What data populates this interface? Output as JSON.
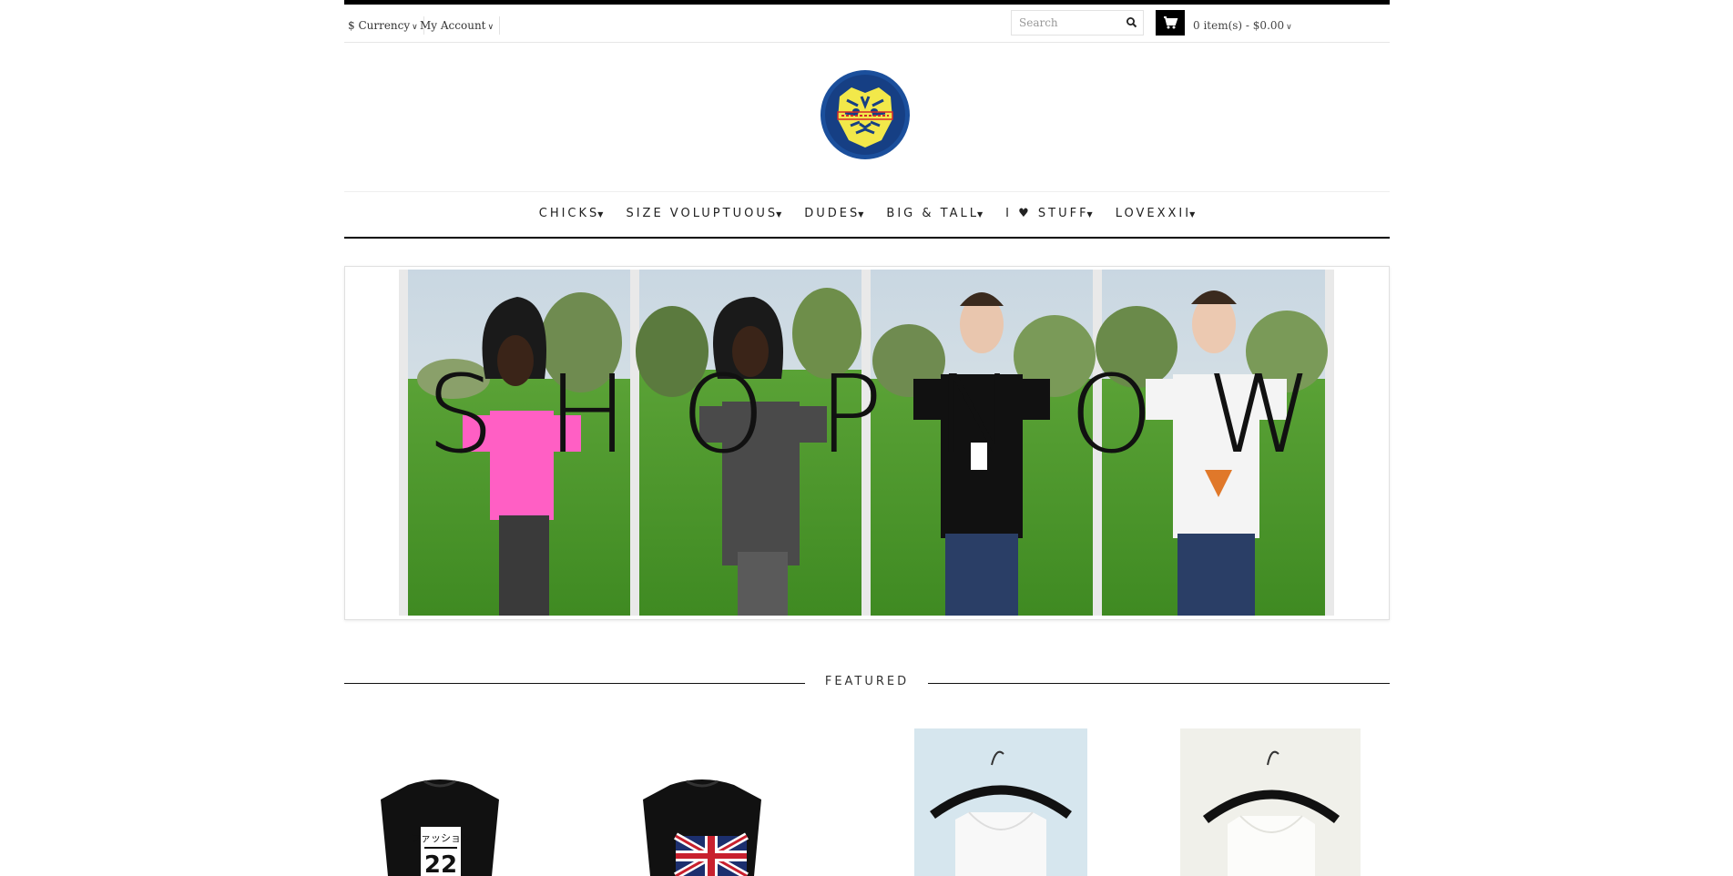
{
  "header": {
    "currency_label": "$ Currency",
    "account_label": "My Account",
    "search_placeholder": "Search",
    "cart_summary": "0 item(s) - $0.00"
  },
  "logo": {
    "alt": "store logo"
  },
  "nav": [
    {
      "label": "CHICKS"
    },
    {
      "label": "SIZE VOLUPTUOUS"
    },
    {
      "label": "DUDES"
    },
    {
      "label": "BIG & TALL"
    },
    {
      "label": "I ♥ STUFF"
    },
    {
      "label": "LOVEXXII"
    }
  ],
  "banner": {
    "text": "SHOPNOW"
  },
  "featured": {
    "title": "FEATURED"
  },
  "colors": {
    "accent": "#000000",
    "logo_blue": "#1b4f9c",
    "logo_yellow": "#f2e84a",
    "logo_red": "#d42a2a"
  },
  "icons": {
    "search": "search-icon",
    "cart": "cart-icon",
    "caret": "chevron-down-icon"
  },
  "products": [
    {
      "kind": "black-tshirt-japanese-print"
    },
    {
      "kind": "black-tshirt-union-jack"
    },
    {
      "kind": "white-tank-top-on-hanger"
    },
    {
      "kind": "white-tank-top-on-hanger"
    }
  ]
}
